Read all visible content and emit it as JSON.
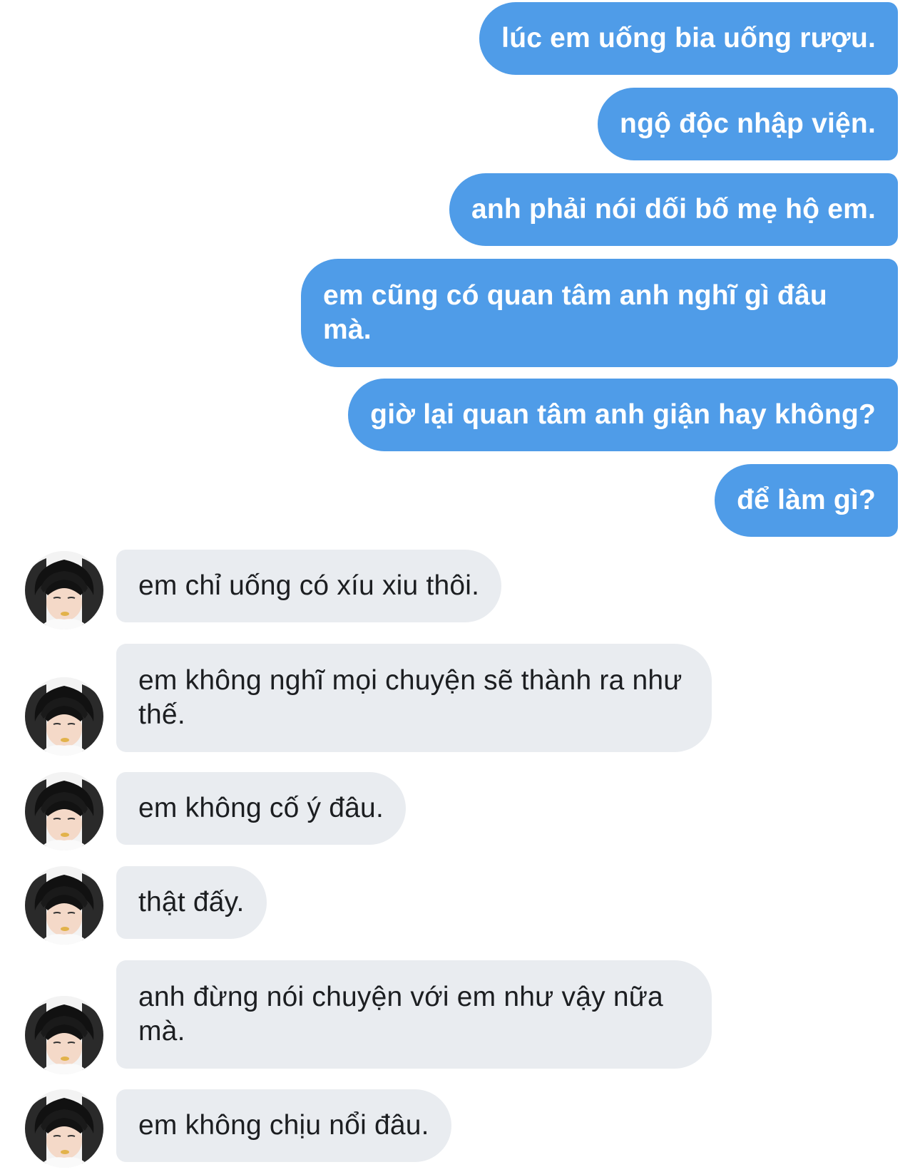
{
  "messages": {
    "outgoing": [
      "lúc em uống bia uống rượu.",
      "ngộ độc nhập viện.",
      "anh phải nói dối bố mẹ hộ em.",
      "em cũng có quan tâm anh nghĩ gì đâu mà.",
      "giờ lại quan tâm anh giận hay không?",
      "để làm gì?"
    ],
    "incoming": [
      "em chỉ uống có xíu xiu thôi.",
      "em không nghĩ mọi chuyện sẽ thành ra như thế.",
      "em không cố ý đâu.",
      "thật đấy.",
      "anh đừng nói chuyện với em như vậy nữa mà.",
      "em không chịu nổi đâu."
    ]
  },
  "colors": {
    "outgoing_bubble": "#4f9ce8",
    "incoming_bubble": "#e9ecf0",
    "incoming_text": "#1c1e21",
    "outgoing_text": "#ffffff"
  },
  "icons": {
    "contact_avatar": "contact-avatar"
  }
}
